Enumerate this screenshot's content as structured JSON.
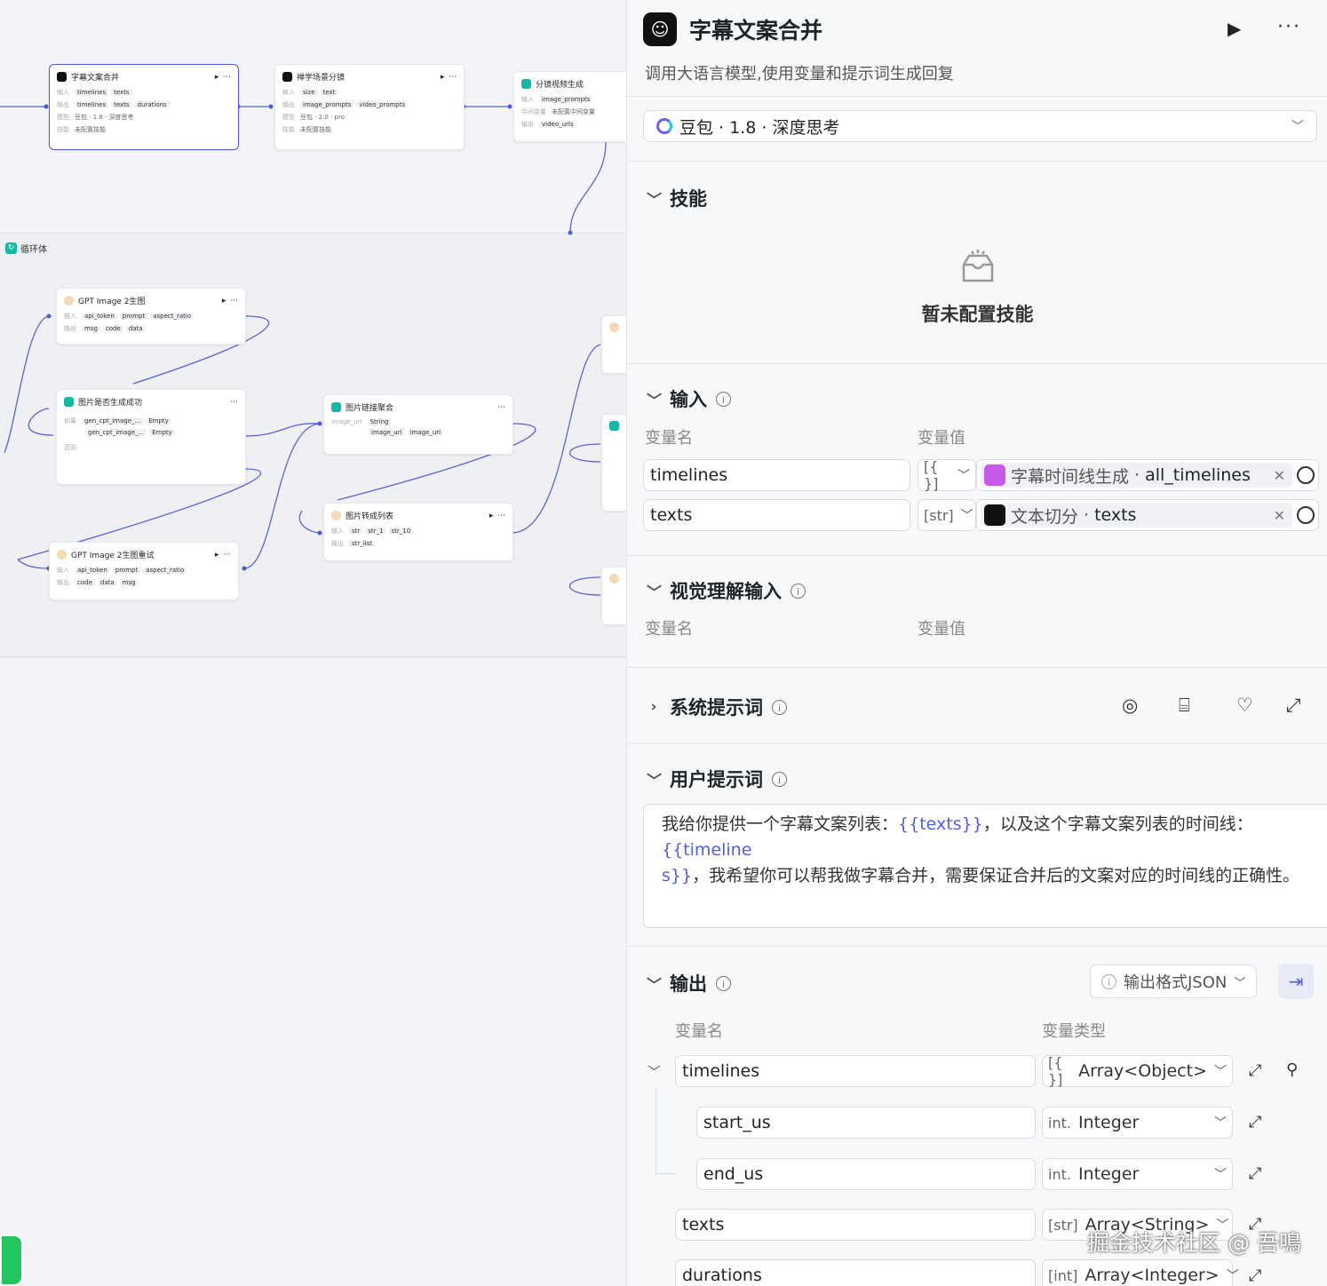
{
  "canvas": {
    "loop_title": "循环体",
    "nodes": [
      {
        "id": "n1",
        "title": "字幕文案合并",
        "rows": [
          [
            "输入",
            "timelines",
            "texts",
            ""
          ],
          [
            "输出",
            "timelines",
            "texts",
            "durations"
          ],
          [
            "模型",
            "豆包 · 1.8 · 深度思考",
            "",
            ""
          ],
          [
            "技能",
            "未配置技能",
            "",
            ""
          ]
        ]
      },
      {
        "id": "n2",
        "title": "禅学场景分镜",
        "rows": [
          [
            "输入",
            "size",
            "text",
            ""
          ],
          [
            "输出",
            "image_prompts",
            "video_prompts",
            ""
          ],
          [
            "模型",
            "豆包 · 2.0 · pro",
            "",
            ""
          ],
          [
            "技能",
            "未配置技能",
            "",
            ""
          ]
        ]
      },
      {
        "id": "n3",
        "title": "分镜视频生成",
        "rows": [
          [
            "输入",
            "image_prompts",
            "",
            ""
          ],
          [
            "中间变量",
            "未配置中间变量",
            "",
            ""
          ],
          [
            "输出",
            "video_urls",
            "",
            ""
          ]
        ]
      },
      {
        "id": "n4",
        "title": "GPT Image 2生图",
        "rows": [
          [
            "输入",
            "api_token",
            "prompt",
            "aspect_ratio"
          ],
          [
            "输出",
            "msg",
            "code",
            "data"
          ]
        ]
      },
      {
        "id": "n5",
        "title": "图片是否生成成功",
        "rows": [
          [
            "如果",
            "gen_cpt_image_...",
            "Empty",
            ""
          ],
          [
            "",
            "gen_cpt_image_...",
            "Empty",
            ""
          ],
          [
            "否则",
            "",
            "",
            ""
          ]
        ]
      },
      {
        "id": "n6",
        "title": "图片链接聚合",
        "rows": [
          [
            "",
            "image_url",
            "String",
            ""
          ],
          [
            "",
            "image_url",
            "image_url",
            ""
          ]
        ]
      },
      {
        "id": "n7",
        "title": "图片转成列表",
        "rows": [
          [
            "输入",
            "str",
            "str_1",
            "str_10"
          ],
          [
            "输出",
            "str_list",
            "",
            ""
          ]
        ]
      },
      {
        "id": "n8",
        "title": "GPT Image 2生图重试",
        "rows": [
          [
            "输入",
            "api_token",
            "prompt",
            "aspect_ratio"
          ],
          [
            "输出",
            "code",
            "data",
            "msg"
          ]
        ]
      }
    ]
  },
  "panel": {
    "title": "字幕文案合并",
    "description": "调用大语言模型,使用变量和提示词生成回复",
    "model": "豆包 · 1.8 · 深度思考",
    "skills": {
      "heading": "技能",
      "empty_text": "暂未配置技能"
    },
    "input": {
      "heading": "输入",
      "col_name": "变量名",
      "col_value": "变量值",
      "rows": [
        {
          "name": "timelines",
          "type_tag": "[{ }]",
          "ref_source": "字幕时间线生成",
          "ref_var": "all_timelines"
        },
        {
          "name": "texts",
          "type_tag": "[str]",
          "ref_source": "文本切分",
          "ref_var": "texts"
        }
      ]
    },
    "vision_input": {
      "heading": "视觉理解输入",
      "col_name": "变量名",
      "col_value": "变量值"
    },
    "system_prompt": {
      "heading": "系统提示词"
    },
    "user_prompt": {
      "heading": "用户提示词",
      "text_1": "我给你提供一个字幕文案列表：",
      "var_1": "{{texts}}",
      "text_2": "，以及这个字幕文案列表的时间线：",
      "var_2a": "{{timeline",
      "var_2b": "s}}",
      "text_3": "，我希望你可以帮我做字幕合并，需要保证合并后的文案对应的时间线的正确性。"
    },
    "output": {
      "heading": "输出",
      "format_button": "输出格式JSON",
      "col_name": "变量名",
      "col_type": "变量类型",
      "rows": [
        {
          "name": "timelines",
          "type_tag": "[{ }]",
          "type": "Array<Object>"
        },
        {
          "name": "start_us",
          "type_tag": "int.",
          "type": "Integer"
        },
        {
          "name": "end_us",
          "type_tag": "int.",
          "type": "Integer"
        },
        {
          "name": "texts",
          "type_tag": "[str]",
          "type": "Array<String>"
        },
        {
          "name": "durations",
          "type_tag": "[int]",
          "type": "Array<Integer>"
        }
      ]
    }
  },
  "watermark": "掘金技术社区 @ 吾鳴",
  "colors": {
    "accent": "#4e5fe0",
    "loop": "#14b8a6",
    "wire": "#4f5bd5"
  }
}
